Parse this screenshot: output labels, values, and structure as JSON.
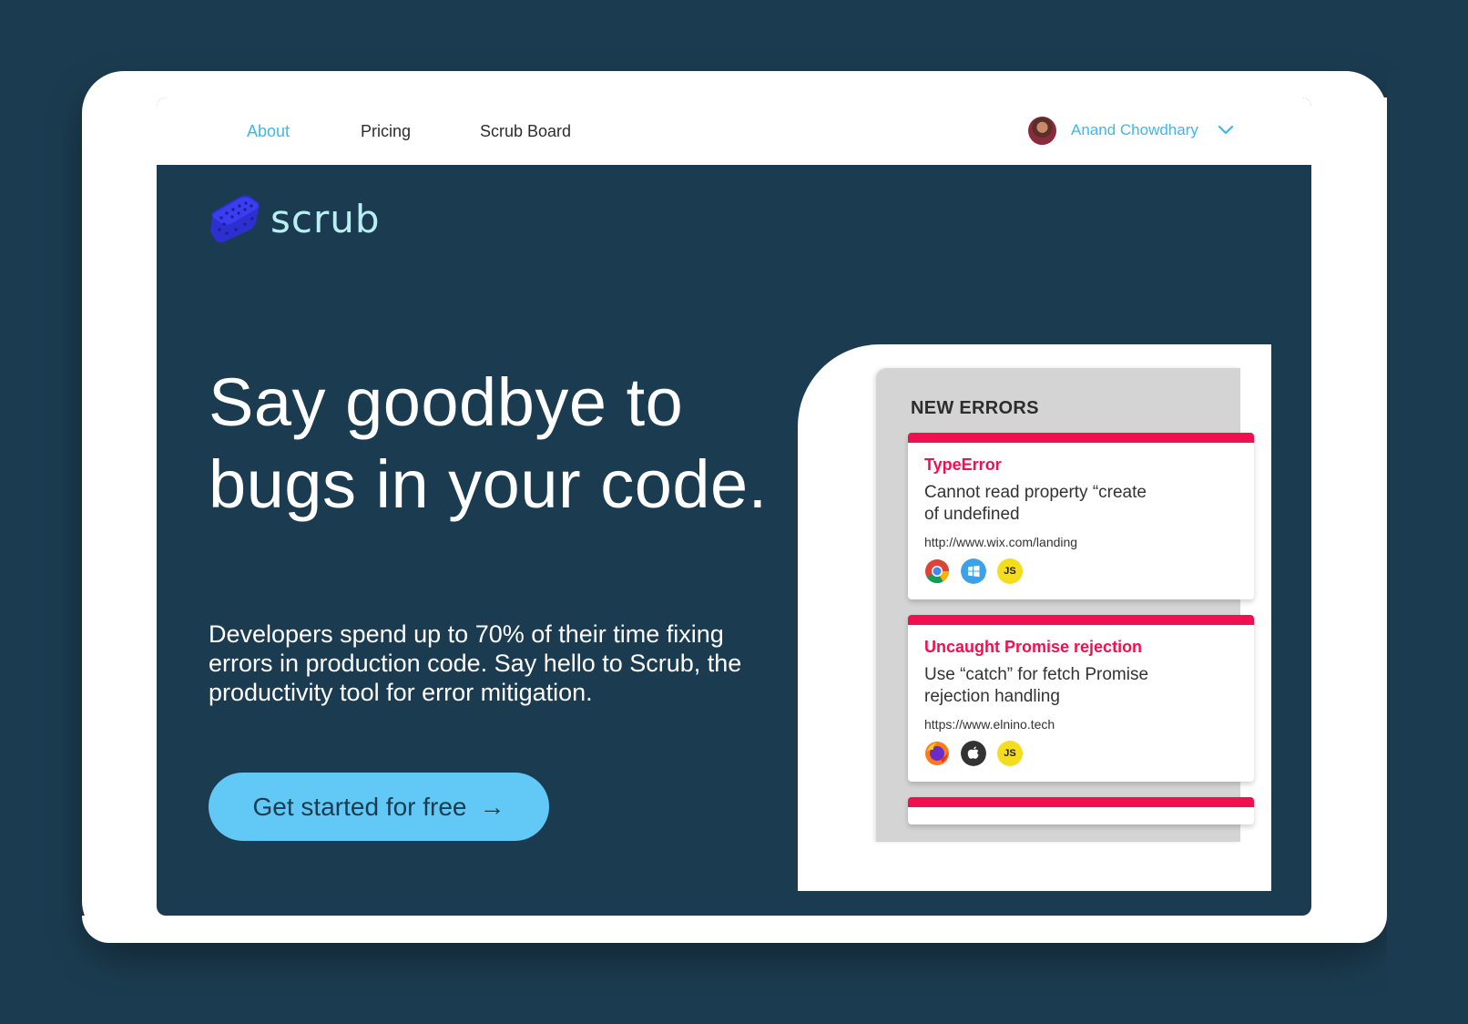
{
  "nav": {
    "links": [
      {
        "label": "About",
        "active": true
      },
      {
        "label": "Pricing",
        "active": false
      },
      {
        "label": "Scrub Board",
        "active": false
      }
    ],
    "user": {
      "name": "Anand Chowdhary"
    }
  },
  "brand": {
    "name": "scrub"
  },
  "hero": {
    "headline_line1": "Say goodbye to",
    "headline_line2": "bugs in your code.",
    "subtext_line1": "Developers spend up to 70% of their time fixing",
    "subtext_line2": "errors in production code. Say hello to Scrub, the",
    "subtext_line3": "productivity tool for error mitigation.",
    "cta_label": "Get started for free",
    "cta_arrow": "→"
  },
  "errors_panel": {
    "title": "NEW ERRORS",
    "cards": [
      {
        "title": "TypeError",
        "message_line1": "Cannot read property “create",
        "message_line2": "of undefined",
        "url": "http://www.wix.com/landing",
        "icons": [
          "chrome-icon",
          "windows-icon",
          "javascript-icon"
        ]
      },
      {
        "title": "Uncaught Promise rejection",
        "message_line1": "Use “catch” for fetch Promise",
        "message_line2": "rejection handling",
        "url": "https://www.elnino.tech",
        "icons": [
          "firefox-icon",
          "apple-icon",
          "javascript-icon"
        ]
      }
    ],
    "js_label": "JS"
  },
  "colors": {
    "background": "#1b3c50",
    "accent": "#42b6ea",
    "cta": "#62c8f5",
    "error": "#f0104f",
    "logo_text": "#b9eef3",
    "logo_sponge": "#3b3df0"
  }
}
